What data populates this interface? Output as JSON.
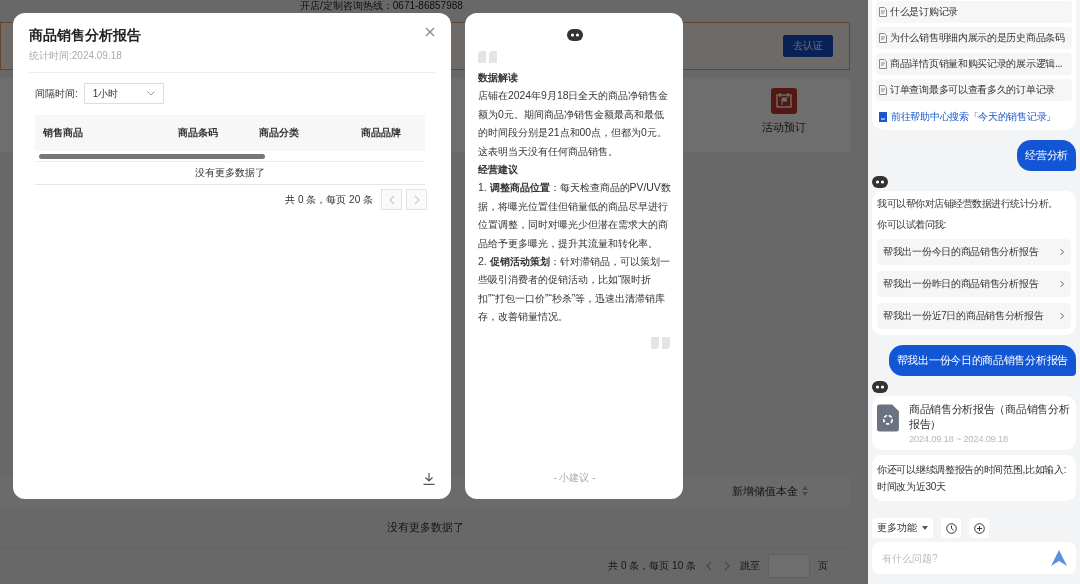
{
  "background_page": {
    "hotline": "开店/定制咨询热线：0671-86857988",
    "verify_button": "去认证",
    "shortcut": {
      "label": "活动预订"
    },
    "table": {
      "columns": [
        "新增储值本金"
      ],
      "empty_text": "没有更多数据了"
    },
    "pagination": {
      "summary": "共 0 条，每页 10 条",
      "jump_label": "跳至",
      "page_unit": "页"
    }
  },
  "report_dialog": {
    "title": "商品销售分析报告",
    "subtitle": "统计时间:2024.09.18",
    "interval_label": "间隔时间:",
    "interval_value": "1小时",
    "table": {
      "columns": [
        "销售商品",
        "商品条码",
        "商品分类",
        "商品品牌"
      ],
      "empty_text": "没有更多数据了"
    },
    "pagination": {
      "summary": "共 0 条，每页 20 条"
    }
  },
  "insight_card": {
    "sections": [
      {
        "heading": "数据解读",
        "paragraphs": [
          "店铺在2024年9月18日全天的商品净销售金额为0元。期间商品净销售金额最高和最低的时间段分别是21点和00点，但都为0元。这表明当天没有任何商品销售。"
        ]
      },
      {
        "heading": "经营建议",
        "paragraphs": [
          "1. **调整商品位置**：每天检查商品的PV/UV数据，将曝光位置佳但销量低的商品尽早进行位置调整，同时对曝光少但潜在需求大的商品给予更多曝光，提升其流量和转化率。",
          "2. **促销活动策划**：针对滞销品，可以策划一些吸引消费者的促销活动，比如“限时折扣”“打包一口价”“秒杀”等，迅速出清滞销库存，改善销量情况。"
        ]
      }
    ],
    "footer": "- 小建议 -"
  },
  "chat": {
    "messages": [
      {
        "kind": "faq",
        "items": [
          "什么是订购记录",
          "为什么销售明细内展示的是历史商品条码",
          "商品详情页销量和购买记录的展示逻辑...",
          "订单查询最多可以查看多久的订单记录"
        ],
        "link": "前往帮助中心搜索「今天的销售记录」"
      },
      {
        "kind": "user",
        "text": "经营分析"
      },
      {
        "kind": "menu",
        "text": "我可以帮你对店铺经营数据进行统计分析。",
        "hint": "你可以试着问我:",
        "suggestions": [
          "帮我出一份今日的商品销售分析报告",
          "帮我出一份昨日的商品销售分析报告",
          "帮我出一份近7日的商品销售分析报告"
        ]
      },
      {
        "kind": "user",
        "text": "帮我出一份今日的商品销售分析报告"
      },
      {
        "kind": "report",
        "title": "商品销售分析报告（商品销售分析报告）",
        "date_range": "2024.09.18 ~ 2024.09.18"
      },
      {
        "kind": "text",
        "text": "你还可以继续调整报告的时间范围,比如输入:时间改为近30天"
      }
    ],
    "toolbar": {
      "more_label": "更多功能"
    },
    "input": {
      "placeholder": "有什么问题?"
    }
  }
}
